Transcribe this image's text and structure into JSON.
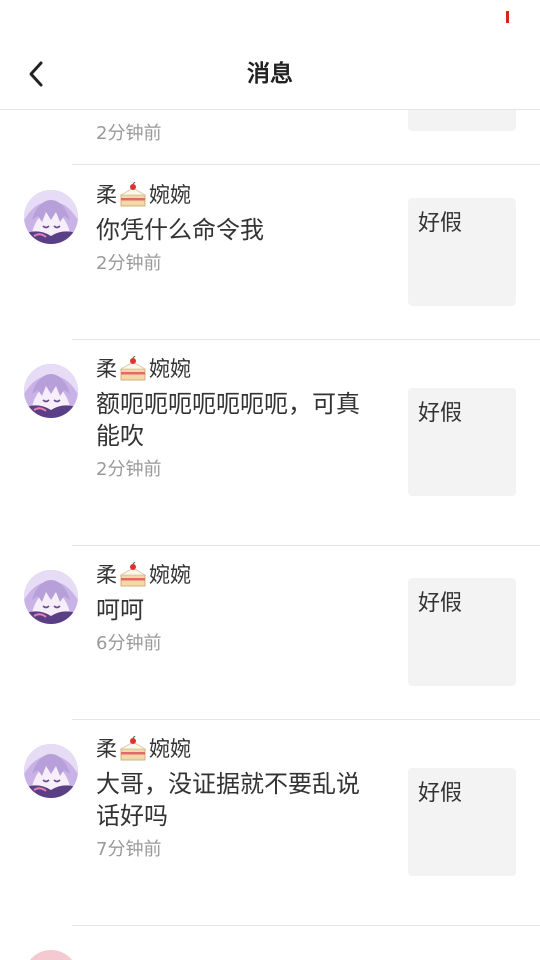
{
  "header": {
    "title": "消息",
    "back_icon": "chevron-left-icon"
  },
  "messages": [
    {
      "time": "2分钟前"
    },
    {
      "user": {
        "name_start": "柔",
        "emoji": "cake-icon",
        "name_end": "婉婉"
      },
      "content": "你凭什么命令我",
      "time": "2分钟前",
      "thumbnail_text": "好假"
    },
    {
      "user": {
        "name_start": "柔",
        "emoji": "cake-icon",
        "name_end": "婉婉"
      },
      "content": "额呃呃呃呃呃呃呃，可真能吹",
      "time": "2分钟前",
      "thumbnail_text": "好假"
    },
    {
      "user": {
        "name_start": "柔",
        "emoji": "cake-icon",
        "name_end": "婉婉"
      },
      "content": "呵呵",
      "time": "6分钟前",
      "thumbnail_text": "好假"
    },
    {
      "user": {
        "name_start": "柔",
        "emoji": "cake-icon",
        "name_end": "婉婉"
      },
      "content": "大哥，没证据就不要乱说话好吗",
      "time": "7分钟前",
      "thumbnail_text": "好假"
    }
  ],
  "colors": {
    "accent": "#e02020",
    "text": "#333333",
    "secondary_text": "#999999",
    "divider": "#e5e5e5",
    "thumbnail_bg": "#f3f3f3"
  }
}
